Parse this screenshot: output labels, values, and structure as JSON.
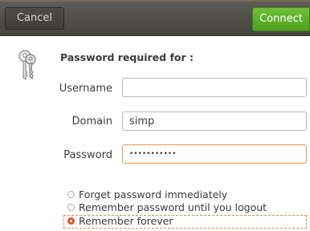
{
  "header": {
    "cancel_label": "Cancel",
    "connect_label": "Connect",
    "colors": {
      "connect": "#5cb026",
      "bar": "#4f4d48"
    }
  },
  "dialog": {
    "title": "Password required for :",
    "icon": "keys-icon",
    "fields": {
      "username": {
        "label": "Username",
        "value": ""
      },
      "domain": {
        "label": "Domain",
        "value": "simp"
      },
      "password": {
        "label": "Password",
        "value": "•••••••••••"
      }
    },
    "options": [
      {
        "label": "Forget password immediately",
        "checked": false
      },
      {
        "label": "Remember password until you logout",
        "checked": false
      },
      {
        "label": "Remember forever",
        "checked": true
      }
    ],
    "accent_color": "#d8531e"
  }
}
